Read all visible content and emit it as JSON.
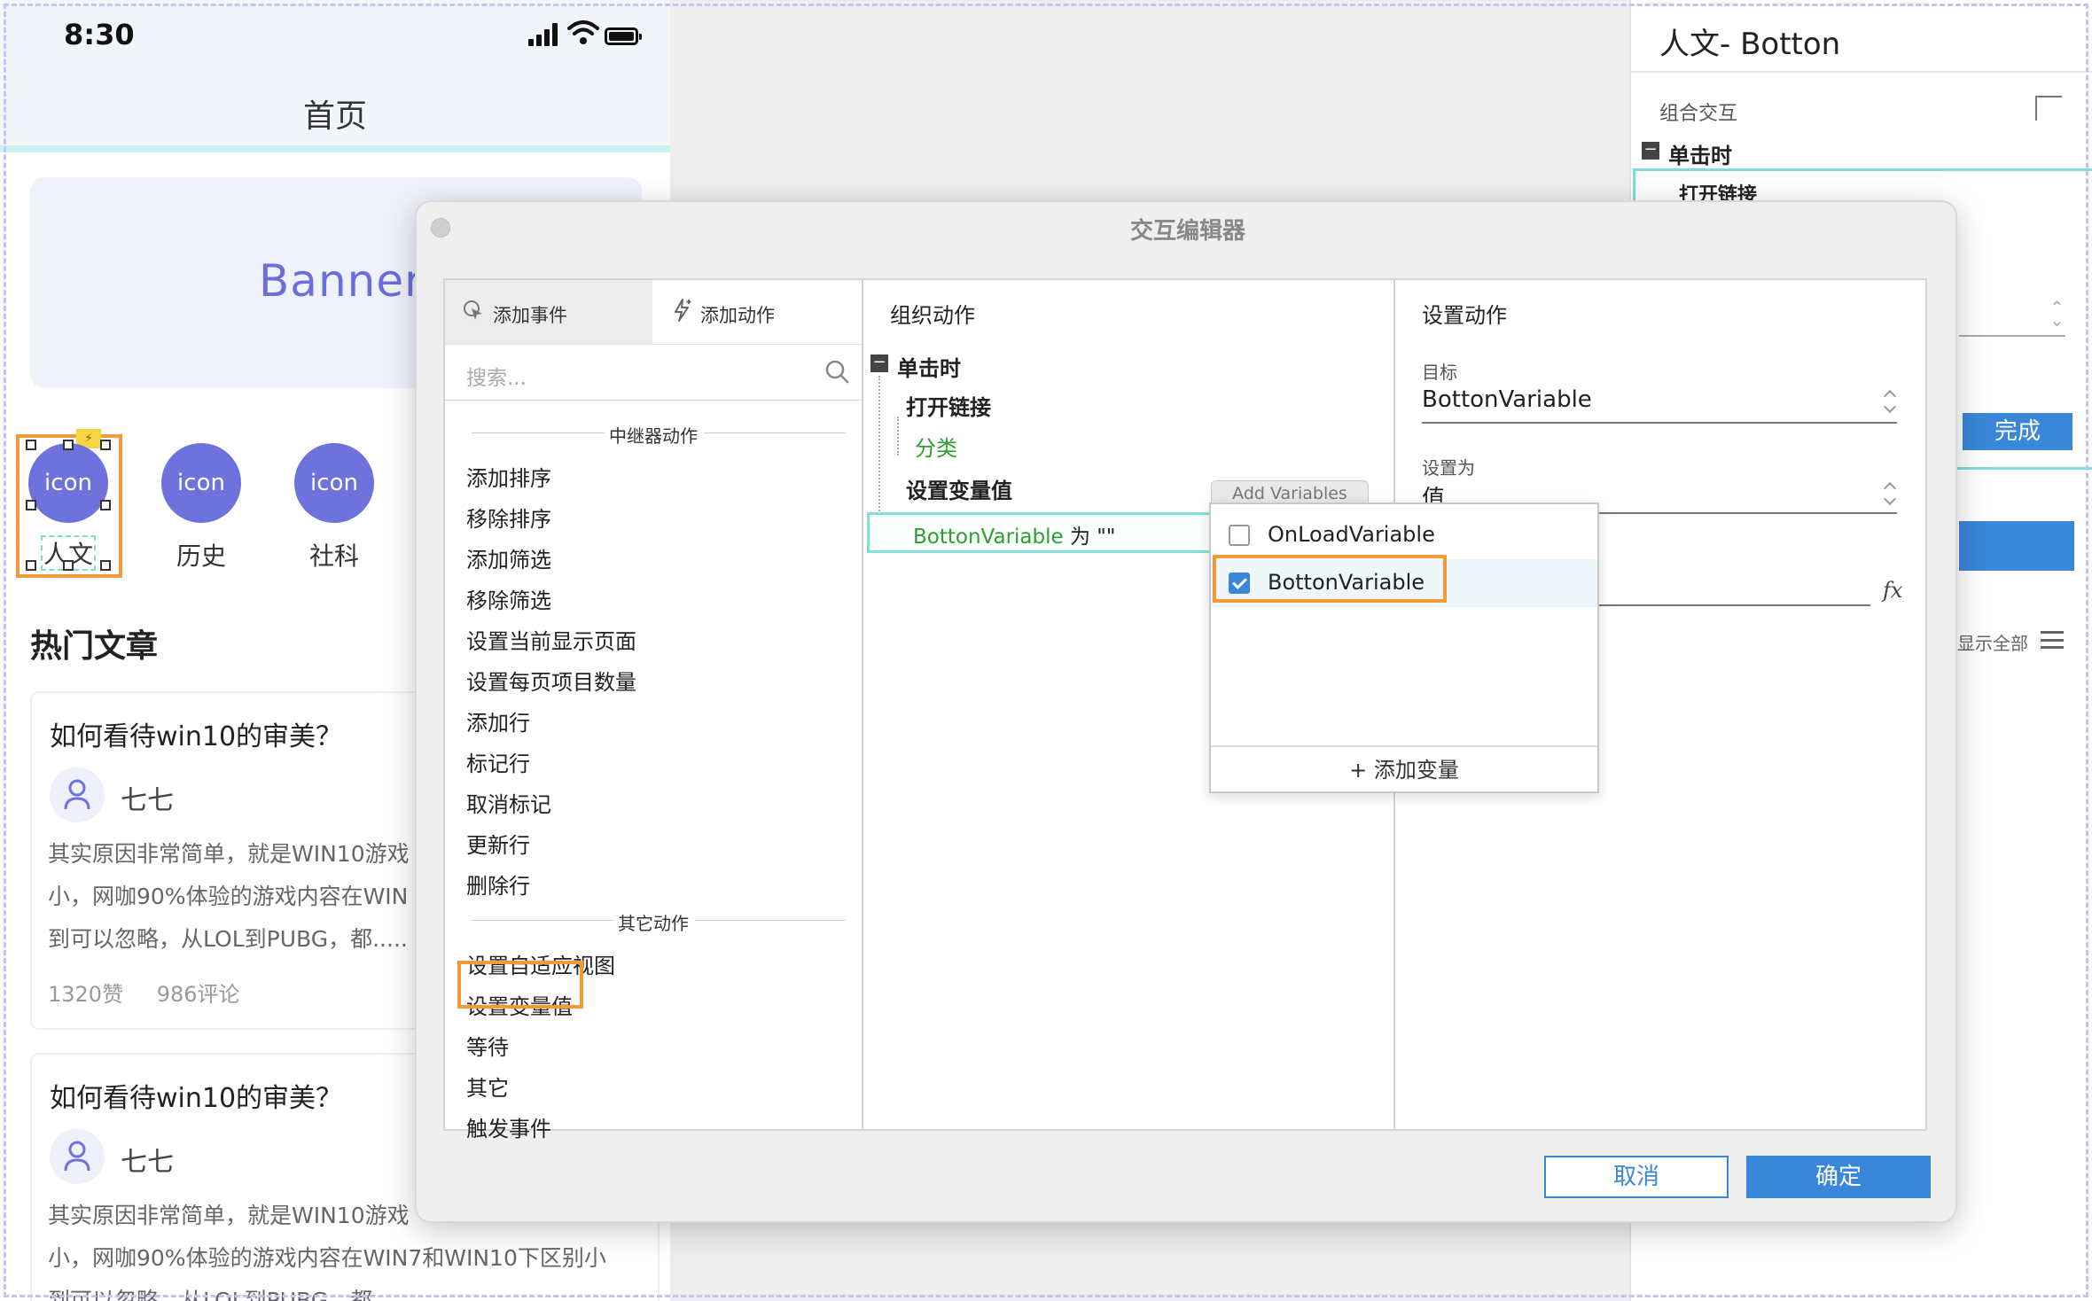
{
  "status_bar": {
    "time": "8:30"
  },
  "phone": {
    "nav_title": "首页",
    "banner_text": "Banner",
    "icons": [
      {
        "circle": "icon",
        "label": "人文"
      },
      {
        "circle": "icon",
        "label": "历史"
      },
      {
        "circle": "icon",
        "label": "社科"
      }
    ],
    "section_title": "热门文章",
    "articles": [
      {
        "title": "如何看待win10的审美？",
        "author": "七七",
        "body_lines": [
          "其实原因非常简单，就是WIN10游戏",
          "小，网咖90%体验的游戏内容在WIN",
          "到可以忽略，从LOL到PUBG，都....."
        ],
        "likes": "1320赞",
        "comments": "986评论"
      },
      {
        "title": "如何看待win10的审美？",
        "author": "七七",
        "body_lines": [
          "其实原因非常简单，就是WIN10游戏",
          "小，网咖90%体验的游戏内容在WIN7和WIN10下区别小",
          "到可以忽略，从LOL到PUBG，都"
        ]
      }
    ]
  },
  "inspector": {
    "title": "人文- Botton",
    "group_label": "组合交互",
    "trigger": "单击时",
    "action": "打开链接",
    "done_label": "完成",
    "show_all": "显示全部"
  },
  "modal": {
    "title": "交互编辑器",
    "tabs": {
      "add_event": "添加事件",
      "add_action": "添加动作"
    },
    "search_placeholder": "搜索...",
    "groups": [
      {
        "title": "中继器动作",
        "items": [
          "添加排序",
          "移除排序",
          "添加筛选",
          "移除筛选",
          "设置当前显示页面",
          "设置每页项目数量",
          "添加行",
          "标记行",
          "取消标记",
          "更新行",
          "删除行"
        ]
      },
      {
        "title": "其它动作",
        "items": [
          "设置自适应视图",
          "设置变量值",
          "等待",
          "其它",
          "触发事件"
        ]
      }
    ],
    "organize": {
      "heading": "组织动作",
      "trigger": "单击时",
      "action1": "打开链接",
      "action1_target": "分类",
      "action2": "设置变量值",
      "add_variables_btn": "Add Variables",
      "assign_var": "BottonVariable",
      "assign_rest": " 为 \"\""
    },
    "settings": {
      "heading": "设置动作",
      "target_label": "目标",
      "target_value": "BottonVariable",
      "set_to_label": "设置为",
      "set_to_value": "值",
      "fx": "fx"
    },
    "dropdown": {
      "options": [
        {
          "label": "OnLoadVariable",
          "checked": false
        },
        {
          "label": "BottonVariable",
          "checked": true
        }
      ],
      "add_label": "+ 添加变量"
    },
    "cancel_label": "取消",
    "ok_label": "确定"
  },
  "colors": {
    "accent_blue": "#3a86d8",
    "highlight_orange": "#f29a35",
    "icon_purple": "#6e72dc",
    "tree_green": "#2e9e2e"
  }
}
